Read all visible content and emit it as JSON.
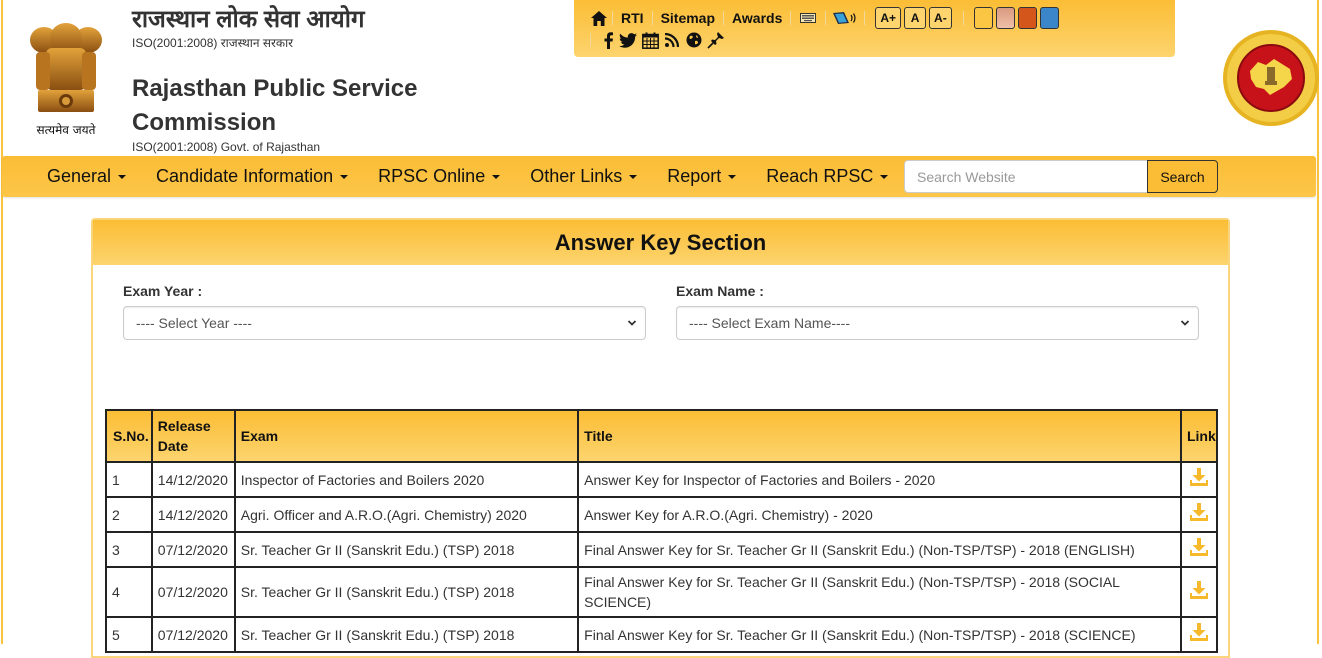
{
  "header": {
    "title_hindi": "राजस्थान लोक सेवा आयोग",
    "subtitle_hindi": "ISO(2001:2008) राजस्थान सरकार",
    "title_english": "Rajasthan Public Service Commission",
    "subtitle_english": "ISO(2001:2008) Govt. of Rajasthan",
    "emblem_motto": "सत्यमेव जयते"
  },
  "toolbox": {
    "links": [
      "RTI",
      "Sitemap",
      "Awards"
    ],
    "font_size_buttons": [
      "A+",
      "A",
      "A-"
    ],
    "theme_colors": [
      "#fcc645",
      "#e2a88e",
      "#d4561a",
      "#3a86c8"
    ],
    "icons_row1": [
      "home-icon",
      "keyboard-icon",
      "screen-reader-icon"
    ],
    "icons_row2": [
      "facebook-icon",
      "twitter-icon",
      "calendar-icon",
      "rss-icon",
      "globe-icon",
      "pin-icon"
    ]
  },
  "navbar": {
    "items": [
      "General",
      "Candidate Information",
      "RPSC Online",
      "Other Links",
      "Report",
      "Reach RPSC"
    ],
    "search_placeholder": "Search Website",
    "search_button": "Search"
  },
  "panel": {
    "title": "Answer Key Section",
    "exam_year_label": "Exam Year :",
    "exam_year_selected": "---- Select Year ----",
    "exam_name_label": "Exam Name :",
    "exam_name_selected": "---- Select Exam Name----"
  },
  "table": {
    "headers": [
      "S.No.",
      "Release Date",
      "Exam",
      "Title",
      "Link"
    ],
    "rows": [
      {
        "sno": "1",
        "date": "14/12/2020",
        "exam": "Inspector of Factories and Boilers 2020",
        "title": "Answer Key for Inspector of Factories and Boilers - 2020"
      },
      {
        "sno": "2",
        "date": "14/12/2020",
        "exam": "Agri. Officer and A.R.O.(Agri. Chemistry) 2020",
        "title": "Answer Key for A.R.O.(Agri. Chemistry) - 2020"
      },
      {
        "sno": "3",
        "date": "07/12/2020",
        "exam": "Sr. Teacher Gr II (Sanskrit Edu.) (TSP) 2018",
        "title": "Final Answer Key for Sr. Teacher Gr II (Sanskrit Edu.) (Non-TSP/TSP) - 2018 (ENGLISH)"
      },
      {
        "sno": "4",
        "date": "07/12/2020",
        "exam": "Sr. Teacher Gr II (Sanskrit Edu.) (TSP) 2018",
        "title": "Final Answer Key for Sr. Teacher Gr II (Sanskrit Edu.) (Non-TSP/TSP) - 2018 (SOCIAL SCIENCE)"
      },
      {
        "sno": "5",
        "date": "07/12/2020",
        "exam": "Sr. Teacher Gr II (Sanskrit Edu.) (TSP) 2018",
        "title": "Final Answer Key for Sr. Teacher Gr II (Sanskrit Edu.) (Non-TSP/TSP) - 2018 (SCIENCE)"
      }
    ]
  },
  "colors": {
    "accent": "#fbbd35",
    "accent_light": "#fdd46e",
    "download_icon": "#f6b92b"
  }
}
